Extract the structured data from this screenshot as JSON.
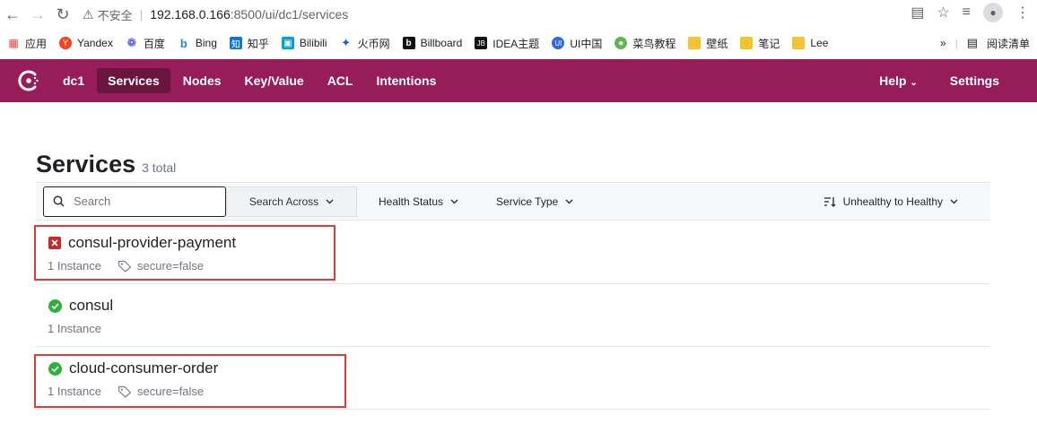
{
  "browser": {
    "insecure_label": "不安全",
    "url_host": "192.168.0.166",
    "url_rest": ":8500/ui/dc1/services",
    "bookmarks": [
      "应用",
      "Yandex",
      "百度",
      "Bing",
      "知乎",
      "Bilibili",
      "火币网",
      "Billboard",
      "IDEA主题",
      "UI中国",
      "菜鸟教程",
      "壁纸",
      "笔记",
      "Lee"
    ],
    "more": "»",
    "reading_list": "阅读清单"
  },
  "nav": {
    "datacenter": "dc1",
    "items": [
      "Services",
      "Nodes",
      "Key/Value",
      "ACL",
      "Intentions"
    ],
    "active": "Services",
    "help": "Help",
    "settings": "Settings"
  },
  "page": {
    "title": "Services",
    "total": "3 total"
  },
  "toolbar": {
    "search_placeholder": "Search",
    "search_across": "Search Across",
    "health_status": "Health Status",
    "service_type": "Service Type",
    "sort": "Unhealthy to Healthy"
  },
  "services": [
    {
      "name": "consul-provider-payment",
      "status": "critical",
      "instances": "1 Instance",
      "tag": "secure=false"
    },
    {
      "name": "consul",
      "status": "passing",
      "instances": "1 Instance",
      "tag": ""
    },
    {
      "name": "cloud-consumer-order",
      "status": "passing",
      "instances": "1 Instance",
      "tag": "secure=false"
    }
  ],
  "colors": {
    "brand": "#961d59",
    "active_nav": "#6a1540",
    "critical": "#c62a2a",
    "passing": "#2eb039",
    "highlight": "#e03a3a"
  }
}
